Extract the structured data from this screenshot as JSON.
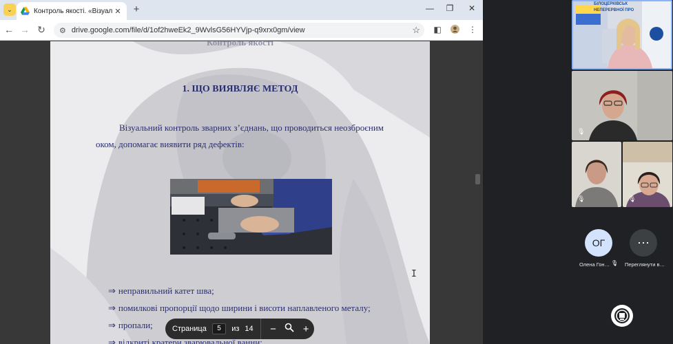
{
  "browser": {
    "tab_title": "Контроль якості. «Візуально-о",
    "tab_close": "✕",
    "new_tab": "+",
    "tab_menu": "⌄",
    "window_controls": {
      "minimize": "—",
      "restore": "❐",
      "close": "✕"
    },
    "url": "drive.google.com/file/d/1of2hweEk2_9WvlsG56HYVjp-q9xrx0gm/view",
    "nav": {
      "back": "←",
      "forward": "→",
      "reload": "↻"
    }
  },
  "document": {
    "top_partial": "Контроль якості",
    "heading": "1.  ЩО ВИЯВЛЯЄ МЕТОД",
    "paragraph": "Візуальний контроль зварних з’єднань, що проводиться неозброєним оком, допомагає виявити ряд дефектів:",
    "bullets": [
      {
        "arrow": "⇒",
        "text": "неправильний катет шва;"
      },
      {
        "arrow": "⇒",
        "text": "помилкові пропорції щодо ширини і висоти наплавленого металу;"
      },
      {
        "arrow": "⇒",
        "text": "пропали;"
      },
      {
        "arrow": "⇒",
        "text": "відкриті кратери зварювальної ванни;"
      }
    ]
  },
  "pager": {
    "label": "Страница",
    "current": "5",
    "of": "из",
    "total": "14",
    "zoom_out": "−",
    "zoom_fit": "⚲",
    "zoom_in": "+"
  },
  "meeting": {
    "participants": [
      {
        "initials": "ОГ",
        "name": "Олена Гон…"
      }
    ],
    "more_label": "Переглянути в…",
    "more_icon": "⋯",
    "banner_text_1": "БІЛОЦЕРКІВСЬК",
    "banner_text_2": "НЕПЕРЕРВНОЇ ПРО"
  }
}
